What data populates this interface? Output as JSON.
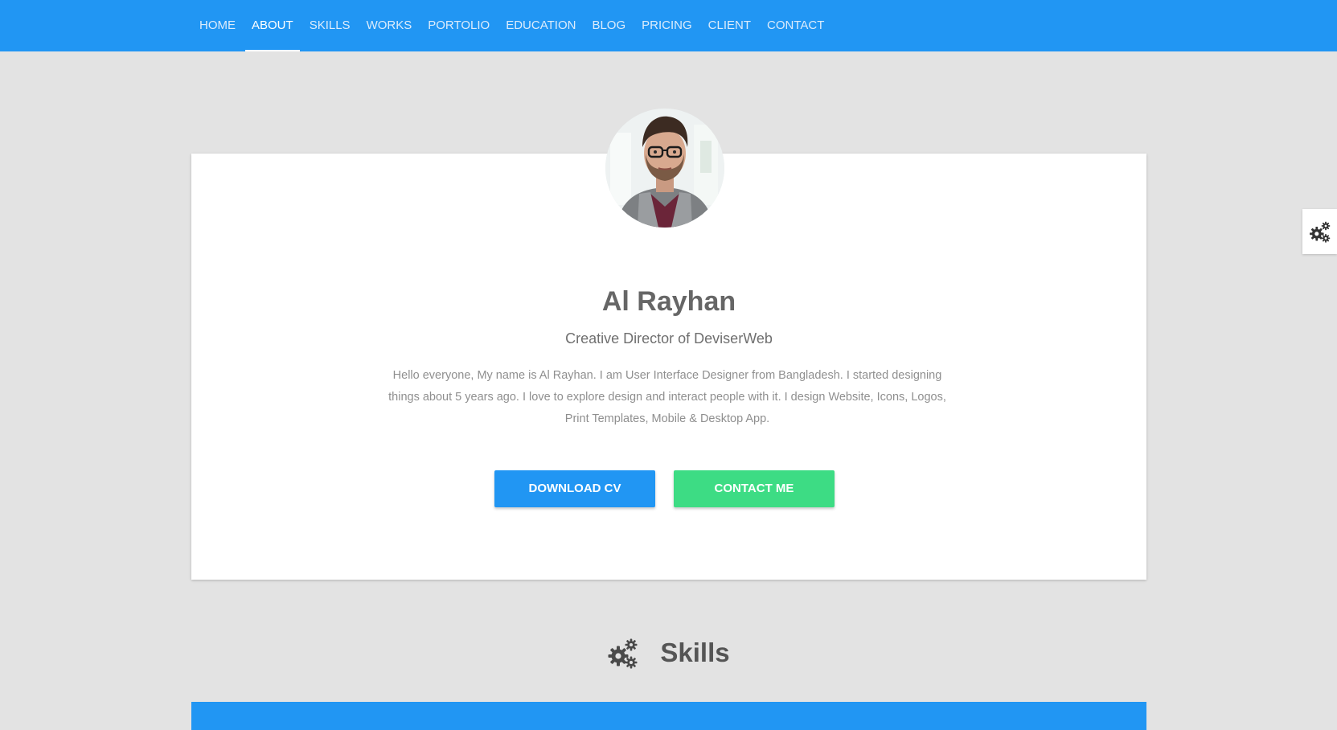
{
  "nav": {
    "items": [
      {
        "label": "HOME",
        "active": false
      },
      {
        "label": "ABOUT",
        "active": true
      },
      {
        "label": "SKILLS",
        "active": false
      },
      {
        "label": "WORKS",
        "active": false
      },
      {
        "label": "PORTOLIO",
        "active": false
      },
      {
        "label": "EDUCATION",
        "active": false
      },
      {
        "label": "BLOG",
        "active": false
      },
      {
        "label": "PRICING",
        "active": false
      },
      {
        "label": "CLIENT",
        "active": false
      },
      {
        "label": "CONTACT",
        "active": false
      }
    ]
  },
  "profile": {
    "name": "Al Rayhan",
    "role": "Creative Director of DeviserWeb",
    "bio": "Hello everyone, My name is Al Rayhan. I am User Interface Designer from Bangladesh. I started designing things about 5 years ago. I love to explore design and interact people with it. I design Website, Icons, Logos, Print Templates, Mobile & Desktop App.",
    "download_label": "DOWNLOAD CV",
    "contact_label": "CONTACT ME",
    "avatar_icon": "avatar-photo"
  },
  "settings": {
    "icon": "gears-icon"
  },
  "skills": {
    "title": "Skills",
    "icon": "gears-icon"
  },
  "colors": {
    "primary": "#2196f3",
    "accent": "#3ddc84",
    "background": "#e3e3e3",
    "card": "#ffffff"
  }
}
